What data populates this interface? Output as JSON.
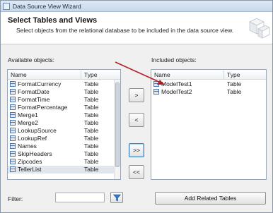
{
  "window": {
    "title": "Data Source View Wizard"
  },
  "header": {
    "title": "Select Tables and Views",
    "subtitle": "Select objects from the relational database to be included in the data source view."
  },
  "available": {
    "label": "Available objects:",
    "columns": {
      "name": "Name",
      "type": "Type"
    },
    "rows": [
      {
        "name": "FormatCurrency",
        "type": "Table"
      },
      {
        "name": "FormatDate",
        "type": "Table"
      },
      {
        "name": "FormatTime",
        "type": "Table"
      },
      {
        "name": "FormatPercentage",
        "type": "Table"
      },
      {
        "name": "Merge1",
        "type": "Table"
      },
      {
        "name": "Merge2",
        "type": "Table"
      },
      {
        "name": "LookupSource",
        "type": "Table"
      },
      {
        "name": "LookupRef",
        "type": "Table"
      },
      {
        "name": "Names",
        "type": "Table"
      },
      {
        "name": "SkipHeaders",
        "type": "Table"
      },
      {
        "name": "Zipcodes",
        "type": "Table"
      },
      {
        "name": "TellerList",
        "type": "Table",
        "selected": true
      }
    ]
  },
  "included": {
    "label": "Included objects:",
    "columns": {
      "name": "Name",
      "type": "Type"
    },
    "rows": [
      {
        "name": "ModelTest1",
        "type": "Table"
      },
      {
        "name": "ModelTest2",
        "type": "Table"
      }
    ]
  },
  "transfer_buttons": {
    "add": ">",
    "remove": "<",
    "add_all": ">>",
    "remove_all": "<<"
  },
  "filter": {
    "label": "Filter:",
    "value": "",
    "icon": "funnel-icon"
  },
  "add_related_button": "Add Related Tables",
  "colors": {
    "annotation_arrow": "#b3202a",
    "selection": "#e1e6ed"
  }
}
